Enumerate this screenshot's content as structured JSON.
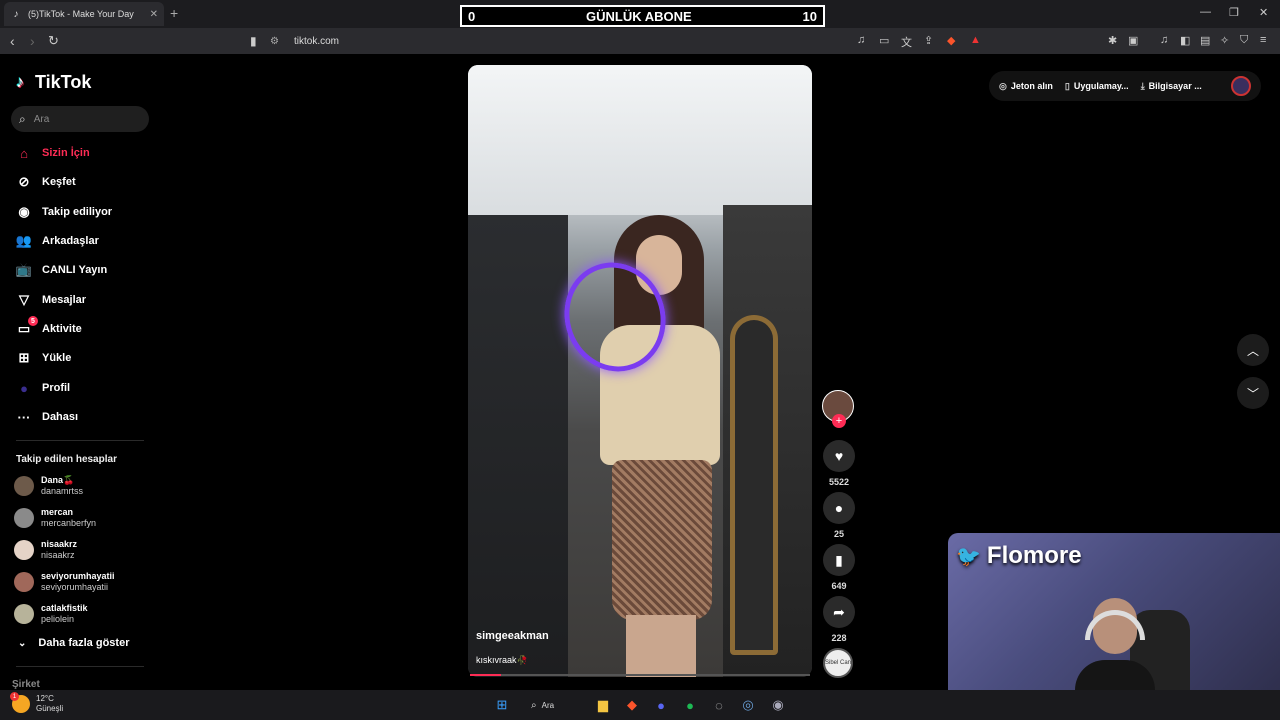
{
  "browser": {
    "tab_title": "(5)TikTok - Make Your Day",
    "tab_close": "✕",
    "new_tab": "+",
    "url": "tiktok.com",
    "window_controls": [
      "—",
      "❐",
      "✕"
    ]
  },
  "overlay": {
    "left_value": "0",
    "title": "GÜNLÜK ABONE",
    "right_value": "10"
  },
  "sidebar": {
    "brand": "TikTok",
    "search_placeholder": "Ara",
    "nav": [
      {
        "label": "Sizin İçin",
        "icon": "home-icon",
        "glyph": "⌂",
        "active": true
      },
      {
        "label": "Keşfet",
        "icon": "compass-icon",
        "glyph": "⊘"
      },
      {
        "label": "Takip ediliyor",
        "icon": "following-avatar-icon",
        "glyph": "◉"
      },
      {
        "label": "Arkadaşlar",
        "icon": "friends-icon",
        "glyph": "👥"
      },
      {
        "label": "CANLI Yayın",
        "icon": "live-icon",
        "glyph": "📺"
      },
      {
        "label": "Mesajlar",
        "icon": "messages-icon",
        "glyph": "▽"
      },
      {
        "label": "Aktivite",
        "icon": "activity-icon",
        "glyph": "▭",
        "badge": "5"
      },
      {
        "label": "Yükle",
        "icon": "upload-icon",
        "glyph": "⊞"
      },
      {
        "label": "Profil",
        "icon": "profile-icon",
        "glyph": "●"
      },
      {
        "label": "Dahası",
        "icon": "more-icon",
        "glyph": "···"
      }
    ],
    "following_title": "Takip edilen hesaplar",
    "following": [
      {
        "name": "Dana🍒",
        "username": "danamrtss"
      },
      {
        "name": "mercan",
        "username": "mercanberfyn"
      },
      {
        "name": "nisaakrz",
        "username": "nisaakrz"
      },
      {
        "name": "seviyorumhayatii",
        "username": "seviyorumhayatii"
      },
      {
        "name": "catlakfistik",
        "username": "peliolein"
      }
    ],
    "show_more": "Daha fazla göster",
    "company": "Şirket"
  },
  "video": {
    "username": "simgeeakman",
    "caption": "kıskıvraak🥀",
    "progress": 0.09
  },
  "actions": {
    "likes": "5522",
    "comments": "25",
    "saves": "649",
    "shares": "228",
    "music_label": "Sibel Can"
  },
  "topbar": {
    "coins": "Jeton alın",
    "app": "Uygulamay...",
    "desktop": "Bilgisayar ..."
  },
  "webcam": {
    "name": "Flomore"
  },
  "taskbar": {
    "temp": "12°C",
    "weather": "Güneşli",
    "weather_badge": "1",
    "search": "Ara"
  },
  "colors": {
    "accent": "#fe2c55",
    "ring": "#7b3cf0"
  }
}
